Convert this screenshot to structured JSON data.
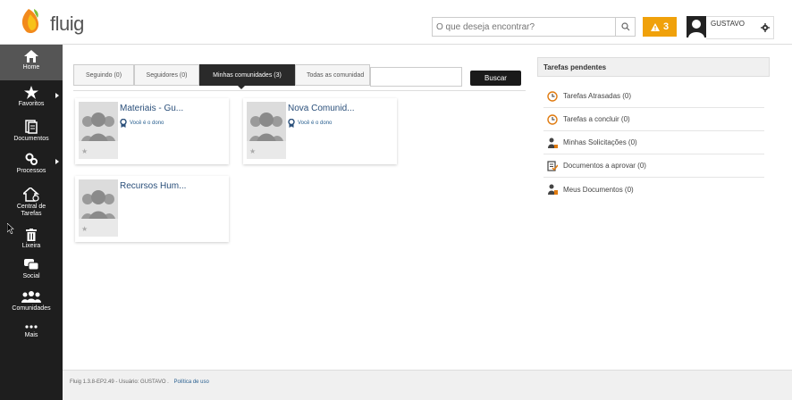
{
  "app": {
    "logo_text": "fluig"
  },
  "header": {
    "search_placeholder": "O que deseja encontrar?",
    "alert_count": "3",
    "user_name": "GUSTAVO"
  },
  "sidebar": {
    "items": [
      {
        "label": "Home",
        "icon": "home-icon"
      },
      {
        "label": "Favoritos",
        "icon": "star-icon"
      },
      {
        "label": "Documentos",
        "icon": "documents-icon"
      },
      {
        "label": "Processos",
        "icon": "processes-icon"
      },
      {
        "label": "Central de Tarefas",
        "icon": "task-center-icon"
      },
      {
        "label": "Lixeira",
        "icon": "trash-icon"
      },
      {
        "label": "Social",
        "icon": "social-icon"
      },
      {
        "label": "Comunidades",
        "icon": "communities-icon"
      },
      {
        "label": "Mais",
        "icon": "more-icon"
      }
    ]
  },
  "tabs": [
    {
      "label": "Seguindo (0)"
    },
    {
      "label": "Seguidores (0)"
    },
    {
      "label": "Minhas comunidades (3)",
      "active": true
    },
    {
      "label": "Todas as comunidad"
    }
  ],
  "community_search": {
    "button": "Buscar"
  },
  "communities": [
    {
      "title": "Materiais - Gu...",
      "owner": "Você é o dono"
    },
    {
      "title": "Nova Comunid...",
      "owner": "Você é o dono"
    },
    {
      "title": "Recursos Hum..."
    }
  ],
  "tasks_panel": {
    "title": "Tarefas pendentes",
    "items": [
      {
        "label": "Tarefas Atrasadas (0)",
        "icon": "clock-icon"
      },
      {
        "label": "Tarefas a concluir (0)",
        "icon": "clock-icon"
      },
      {
        "label": "Minhas Solicitações (0)",
        "icon": "person-icon"
      },
      {
        "label": "Documentos a aprovar (0)",
        "icon": "document-approve-icon"
      },
      {
        "label": "Meus Documentos (0)",
        "icon": "person-document-icon"
      }
    ]
  },
  "footer": {
    "text": "Fluig 1.3.8-EP2.49 - Usuário: GUSTAVO .",
    "link": "Política de uso"
  },
  "colors": {
    "accent": "#f0a10a",
    "link": "#2a4f7a",
    "sidebar": "#1e1e1e"
  }
}
